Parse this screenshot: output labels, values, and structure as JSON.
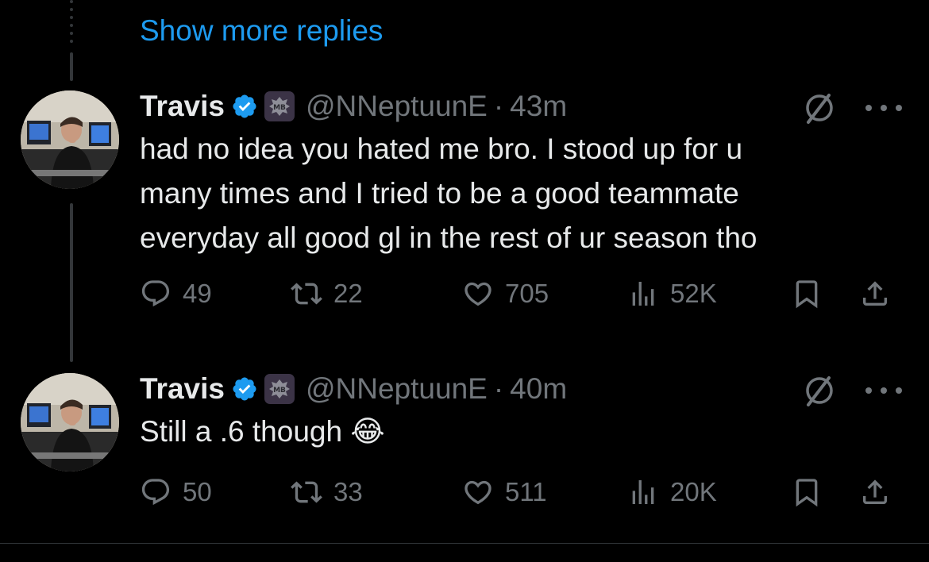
{
  "show_more": "Show more replies",
  "tweets": [
    {
      "name": "Travis",
      "handle": "@NNeptuunE",
      "separator": "·",
      "time": "43m",
      "text_lines": [
        "had no idea you hated me bro. I stood up for u",
        "many times and I tried to be a good teammate",
        "everyday all good gl in the rest of ur season tho"
      ],
      "replies": "49",
      "reposts": "22",
      "likes": "705",
      "views": "52K"
    },
    {
      "name": "Travis",
      "handle": "@NNeptuunE",
      "separator": "·",
      "time": "40m",
      "text_lines": [
        "Still a .6 though 😂"
      ],
      "replies": "50",
      "reposts": "33",
      "likes": "511",
      "views": "20K"
    }
  ],
  "affiliate_badge": "MB",
  "colors": {
    "accent": "#1d9bf0",
    "muted": "#71767b",
    "text": "#e7e9ea",
    "background": "#000000"
  },
  "icons": [
    "verified-badge-icon",
    "grok-icon",
    "more-icon",
    "reply-icon",
    "repost-icon",
    "like-icon",
    "views-icon",
    "bookmark-icon",
    "share-icon"
  ]
}
